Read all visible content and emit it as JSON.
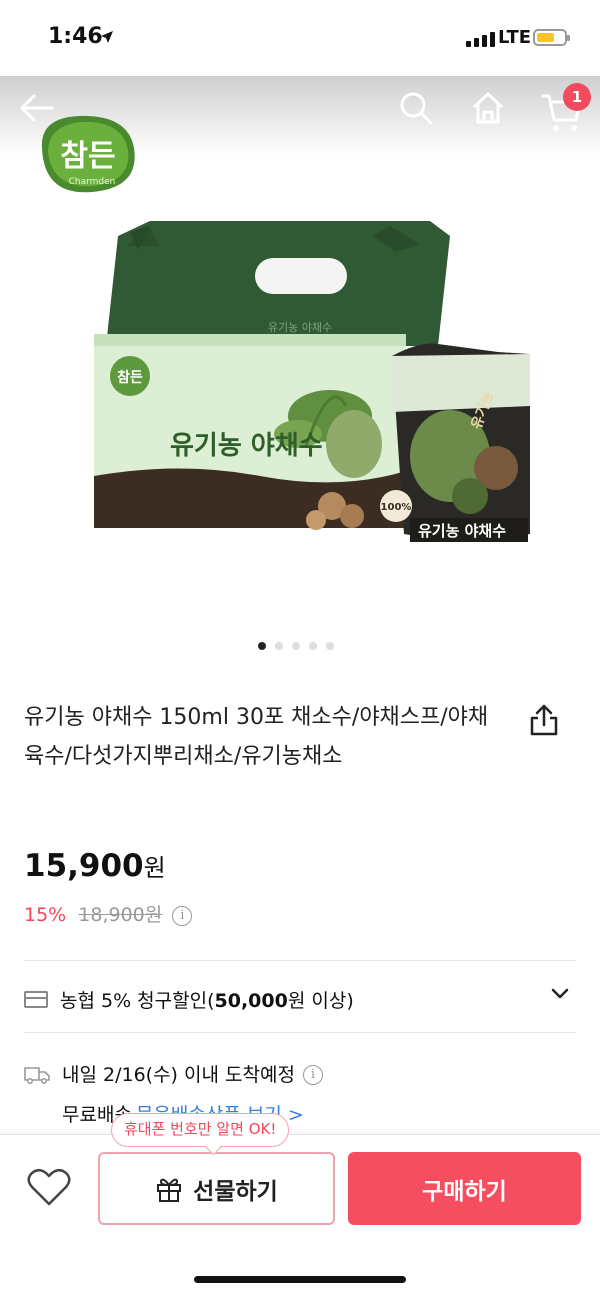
{
  "status_bar": {
    "time": "1:46",
    "network": "LTE"
  },
  "nav": {
    "cart_count": "1"
  },
  "brand": {
    "logo_main": "참든",
    "logo_sub": "Charmden"
  },
  "product_image": {
    "box_label": "유기농 야채수",
    "box_small": "참든",
    "pouch_label": "유기농 야채수",
    "pouch_side": "유기농",
    "pouch_badge": "100%"
  },
  "carousel": {
    "count": 5,
    "active": 0
  },
  "product": {
    "title": "유기농 야채수 150ml 30포 채소수/야채스프/야채육수/다섯가지뿌리채소/유기농채소",
    "price": "15,900",
    "price_unit": "원",
    "discount": "15%",
    "original_price": "18,900원"
  },
  "benefit": {
    "card_prefix": "농협 5% 청구할인(",
    "card_bold": "50,000",
    "card_suffix": "원 이상)"
  },
  "shipping": {
    "arrival": "내일 2/16(수) 이내 도착예정",
    "free_label": "무료배송",
    "free_link": "묶음배송상품 보기 >"
  },
  "bottom": {
    "tooltip": "휴대폰 번호만 알면 OK!",
    "gift_label": "선물하기",
    "buy_label": "구매하기"
  },
  "colors": {
    "accent": "#f54e61",
    "brand_green": "#3d6b3d"
  }
}
